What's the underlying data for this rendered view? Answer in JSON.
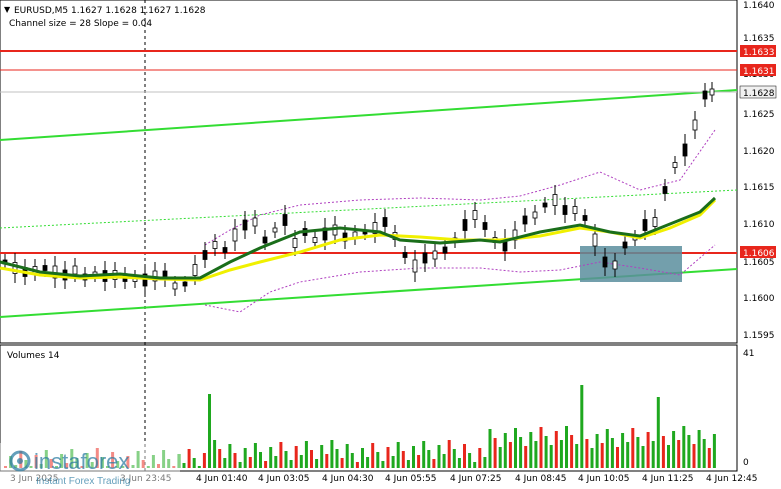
{
  "header": {
    "symbol_line": "EURUSD,M5  1.1627 1.1628 1.1627 1.1628",
    "channel_line": "Channel size = 28 Slope = 0.04"
  },
  "volumes_label": "Volumes 14",
  "price_axis": {
    "ticks": [
      "1.1640",
      "1.1635",
      "1.1630",
      "1.1625",
      "1.1620",
      "1.1615",
      "1.1610",
      "1.1605",
      "1.1600",
      "1.1595"
    ],
    "highlight_labels": [
      {
        "text": "1.1633",
        "bg": "#e8261c",
        "fg": "#ffffff"
      },
      {
        "text": "1.1631",
        "bg": "#e8261c",
        "fg": "#ffffff"
      },
      {
        "text": "1.1628",
        "bg": "#f0f0f0",
        "fg": "#000000"
      },
      {
        "text": "1.1606",
        "bg": "#e8261c",
        "fg": "#ffffff"
      }
    ]
  },
  "volume_axis": {
    "ticks": [
      "41",
      "0"
    ]
  },
  "time_axis": {
    "ticks": [
      "3 Jun 2025",
      "3 Jun 23:45",
      "4 Jun 01:40",
      "4 Jun 03:05",
      "4 Jun 04:30",
      "4 Jun 05:55",
      "4 Jun 07:25",
      "4 Jun 08:45",
      "4 Jun 10:05",
      "4 Jun 11:25",
      "4 Jun 12:45"
    ]
  },
  "watermark": {
    "brand": "instaforex",
    "tagline": "Instant Forex Trading"
  },
  "colors": {
    "bull_candle": "#000000",
    "bear_candle": "#000000",
    "ma_fast": "#1a6e1a",
    "ma_slow": "#f0f000",
    "channel": "#33dd33",
    "level_line": "#e8261c",
    "volume_up": "#1fa81f",
    "volume_down": "#e8261c",
    "rect_fill": "#5a8e9e"
  }
}
